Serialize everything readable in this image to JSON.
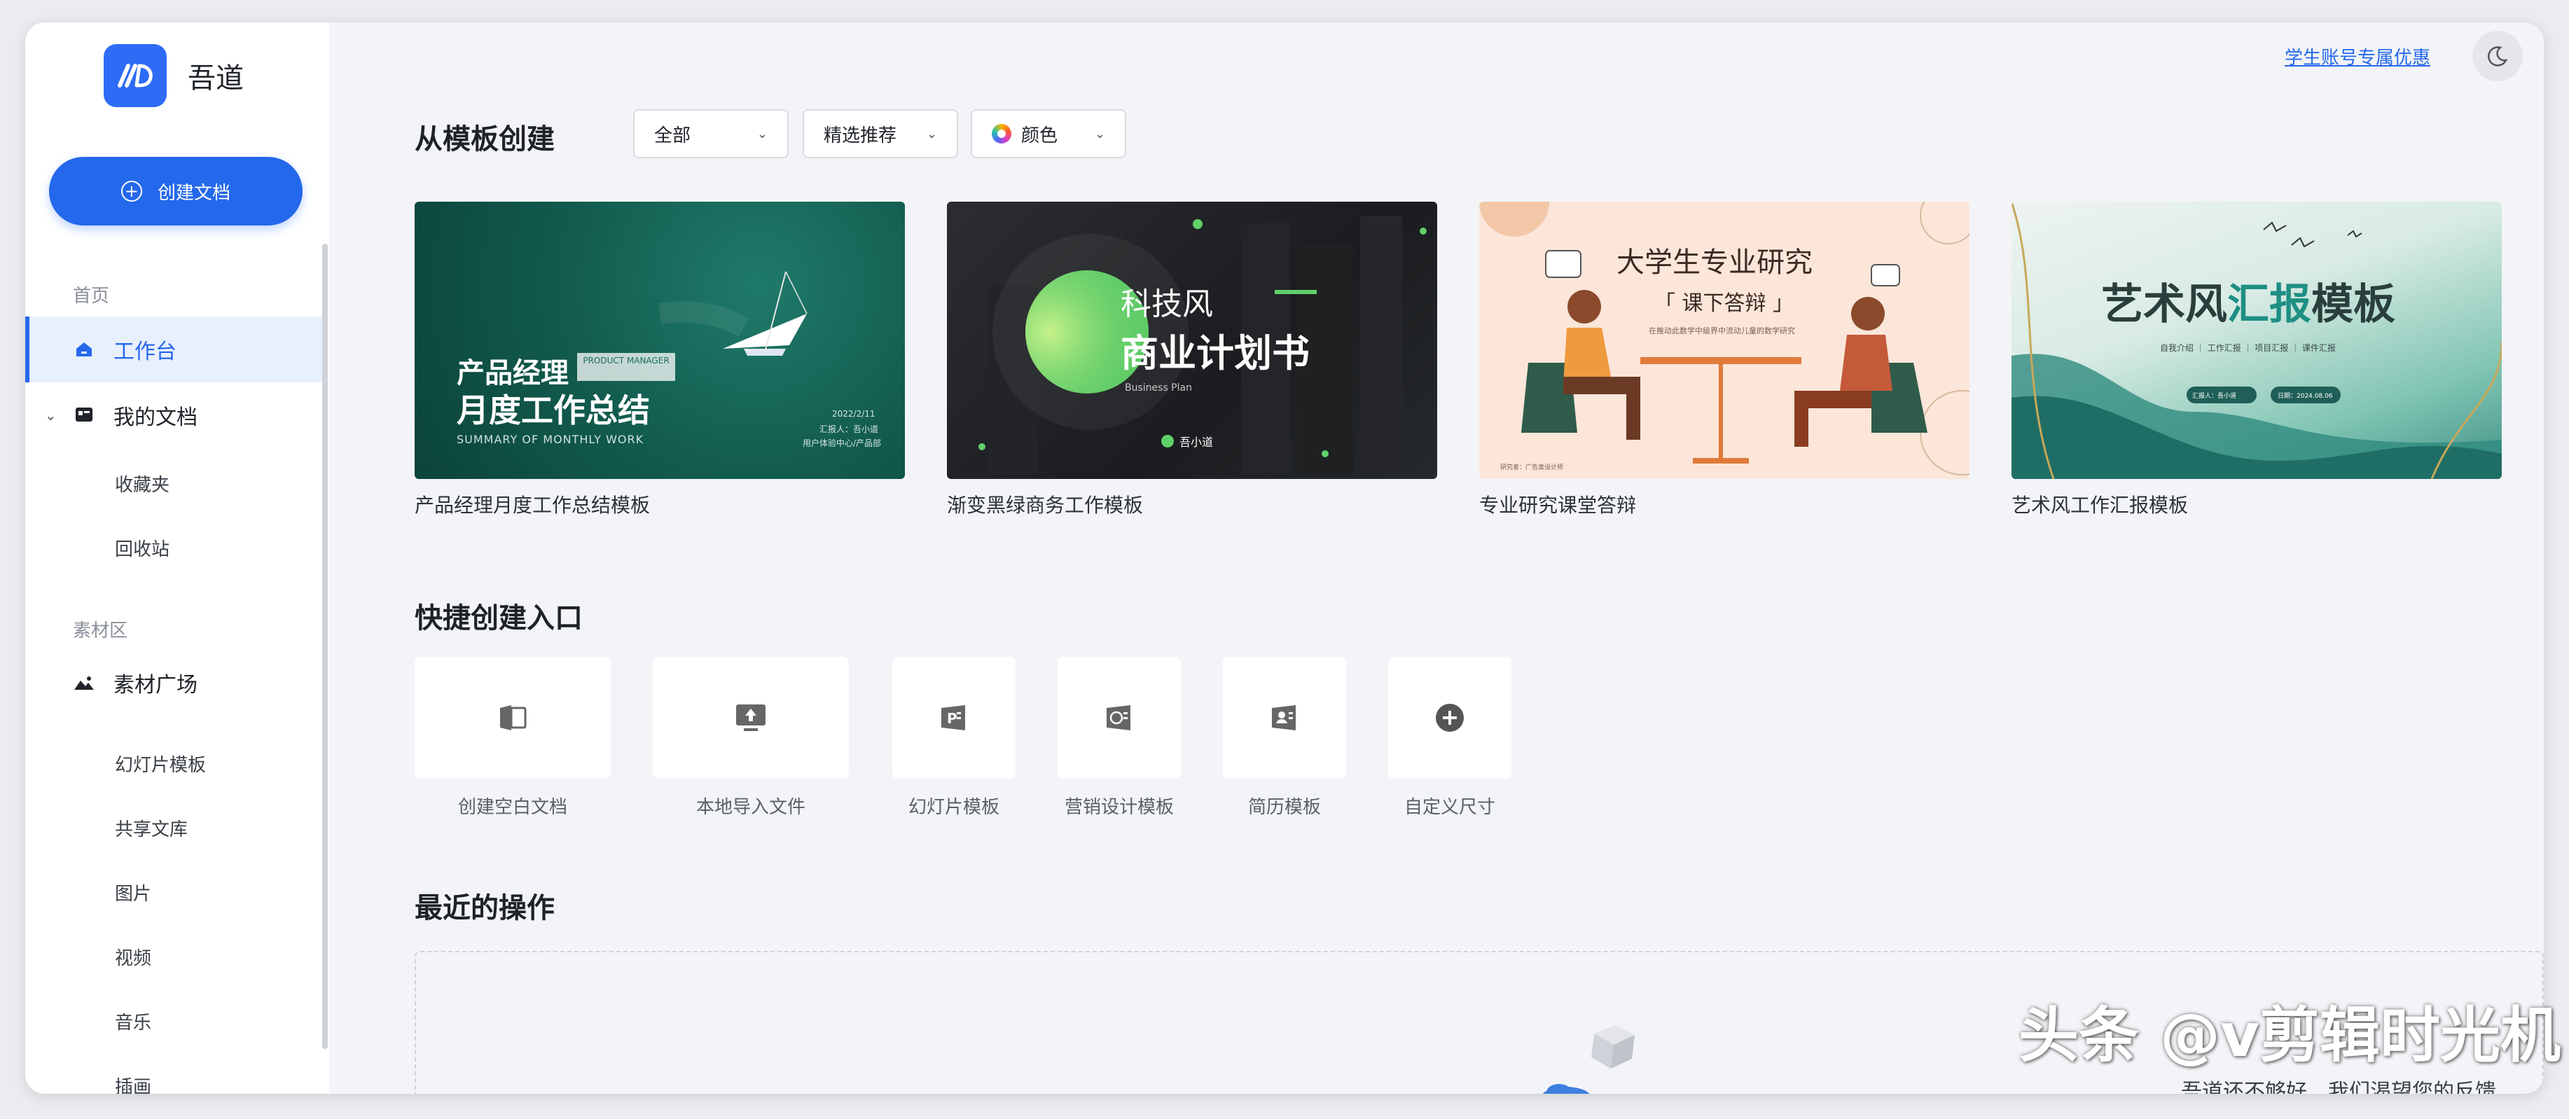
{
  "app": {
    "name": "吾道"
  },
  "sidebar": {
    "create_label": "创建文档",
    "group_home": "首页",
    "workspace": "工作台",
    "my_docs": "我的文档",
    "favorites": "收藏夹",
    "trash": "回收站",
    "group_assets": "素材区",
    "asset_square": "素材广场",
    "slide_templates": "幻灯片模板",
    "shared_library": "共享文库",
    "images": "图片",
    "videos": "视频",
    "music": "音乐",
    "illustrations": "插画"
  },
  "topbar": {
    "student_offer": "学生账号专属优惠"
  },
  "templates": {
    "title": "从模板创建",
    "filter_all": "全部",
    "filter_featured": "精选推荐",
    "filter_color": "颜色",
    "cards": [
      {
        "caption": "产品经理月度工作总结模板",
        "line1": "产品经理",
        "line2": "月度工作总结",
        "tag": "PRODUCT MANAGER",
        "sub": "SUMMARY OF MONTHLY WORK",
        "date": "2022/2/11",
        "reporter": "汇报人：吾小道",
        "dept": "用户体验中心/产品部"
      },
      {
        "caption": "渐变黑绿商务工作模板",
        "line1": "科技风",
        "line2": "商业计划书",
        "sub": "Business Plan",
        "author": "吾小道"
      },
      {
        "caption": "专业研究课堂答辩",
        "line1": "大学生专业研究",
        "line2": "「 课下答辩 」",
        "sub": "在推动此数学中级界中流动儿童的数学研究",
        "reporter": "研究者：广告类设计师"
      },
      {
        "caption": "艺术风工作汇报模板",
        "line1_a": "艺术风",
        "line1_b": "汇报",
        "line1_c": "模板",
        "menu": "自我介绍 ｜ 工作汇报 ｜ 项目汇报 ｜ 课件汇报",
        "reporter": "汇报人：吾小道",
        "date": "日期：2024.08.06"
      }
    ]
  },
  "quick": {
    "title": "快捷创建入口",
    "items": [
      "创建空白文档",
      "本地导入文件",
      "幻灯片模板",
      "营销设计模板",
      "简历模板",
      "自定义尺寸"
    ]
  },
  "recent": {
    "title": "最近的操作",
    "empty_text": "吾道还不够好，我们渴望您的反馈"
  },
  "watermark": "头条 @v剪辑时光机"
}
